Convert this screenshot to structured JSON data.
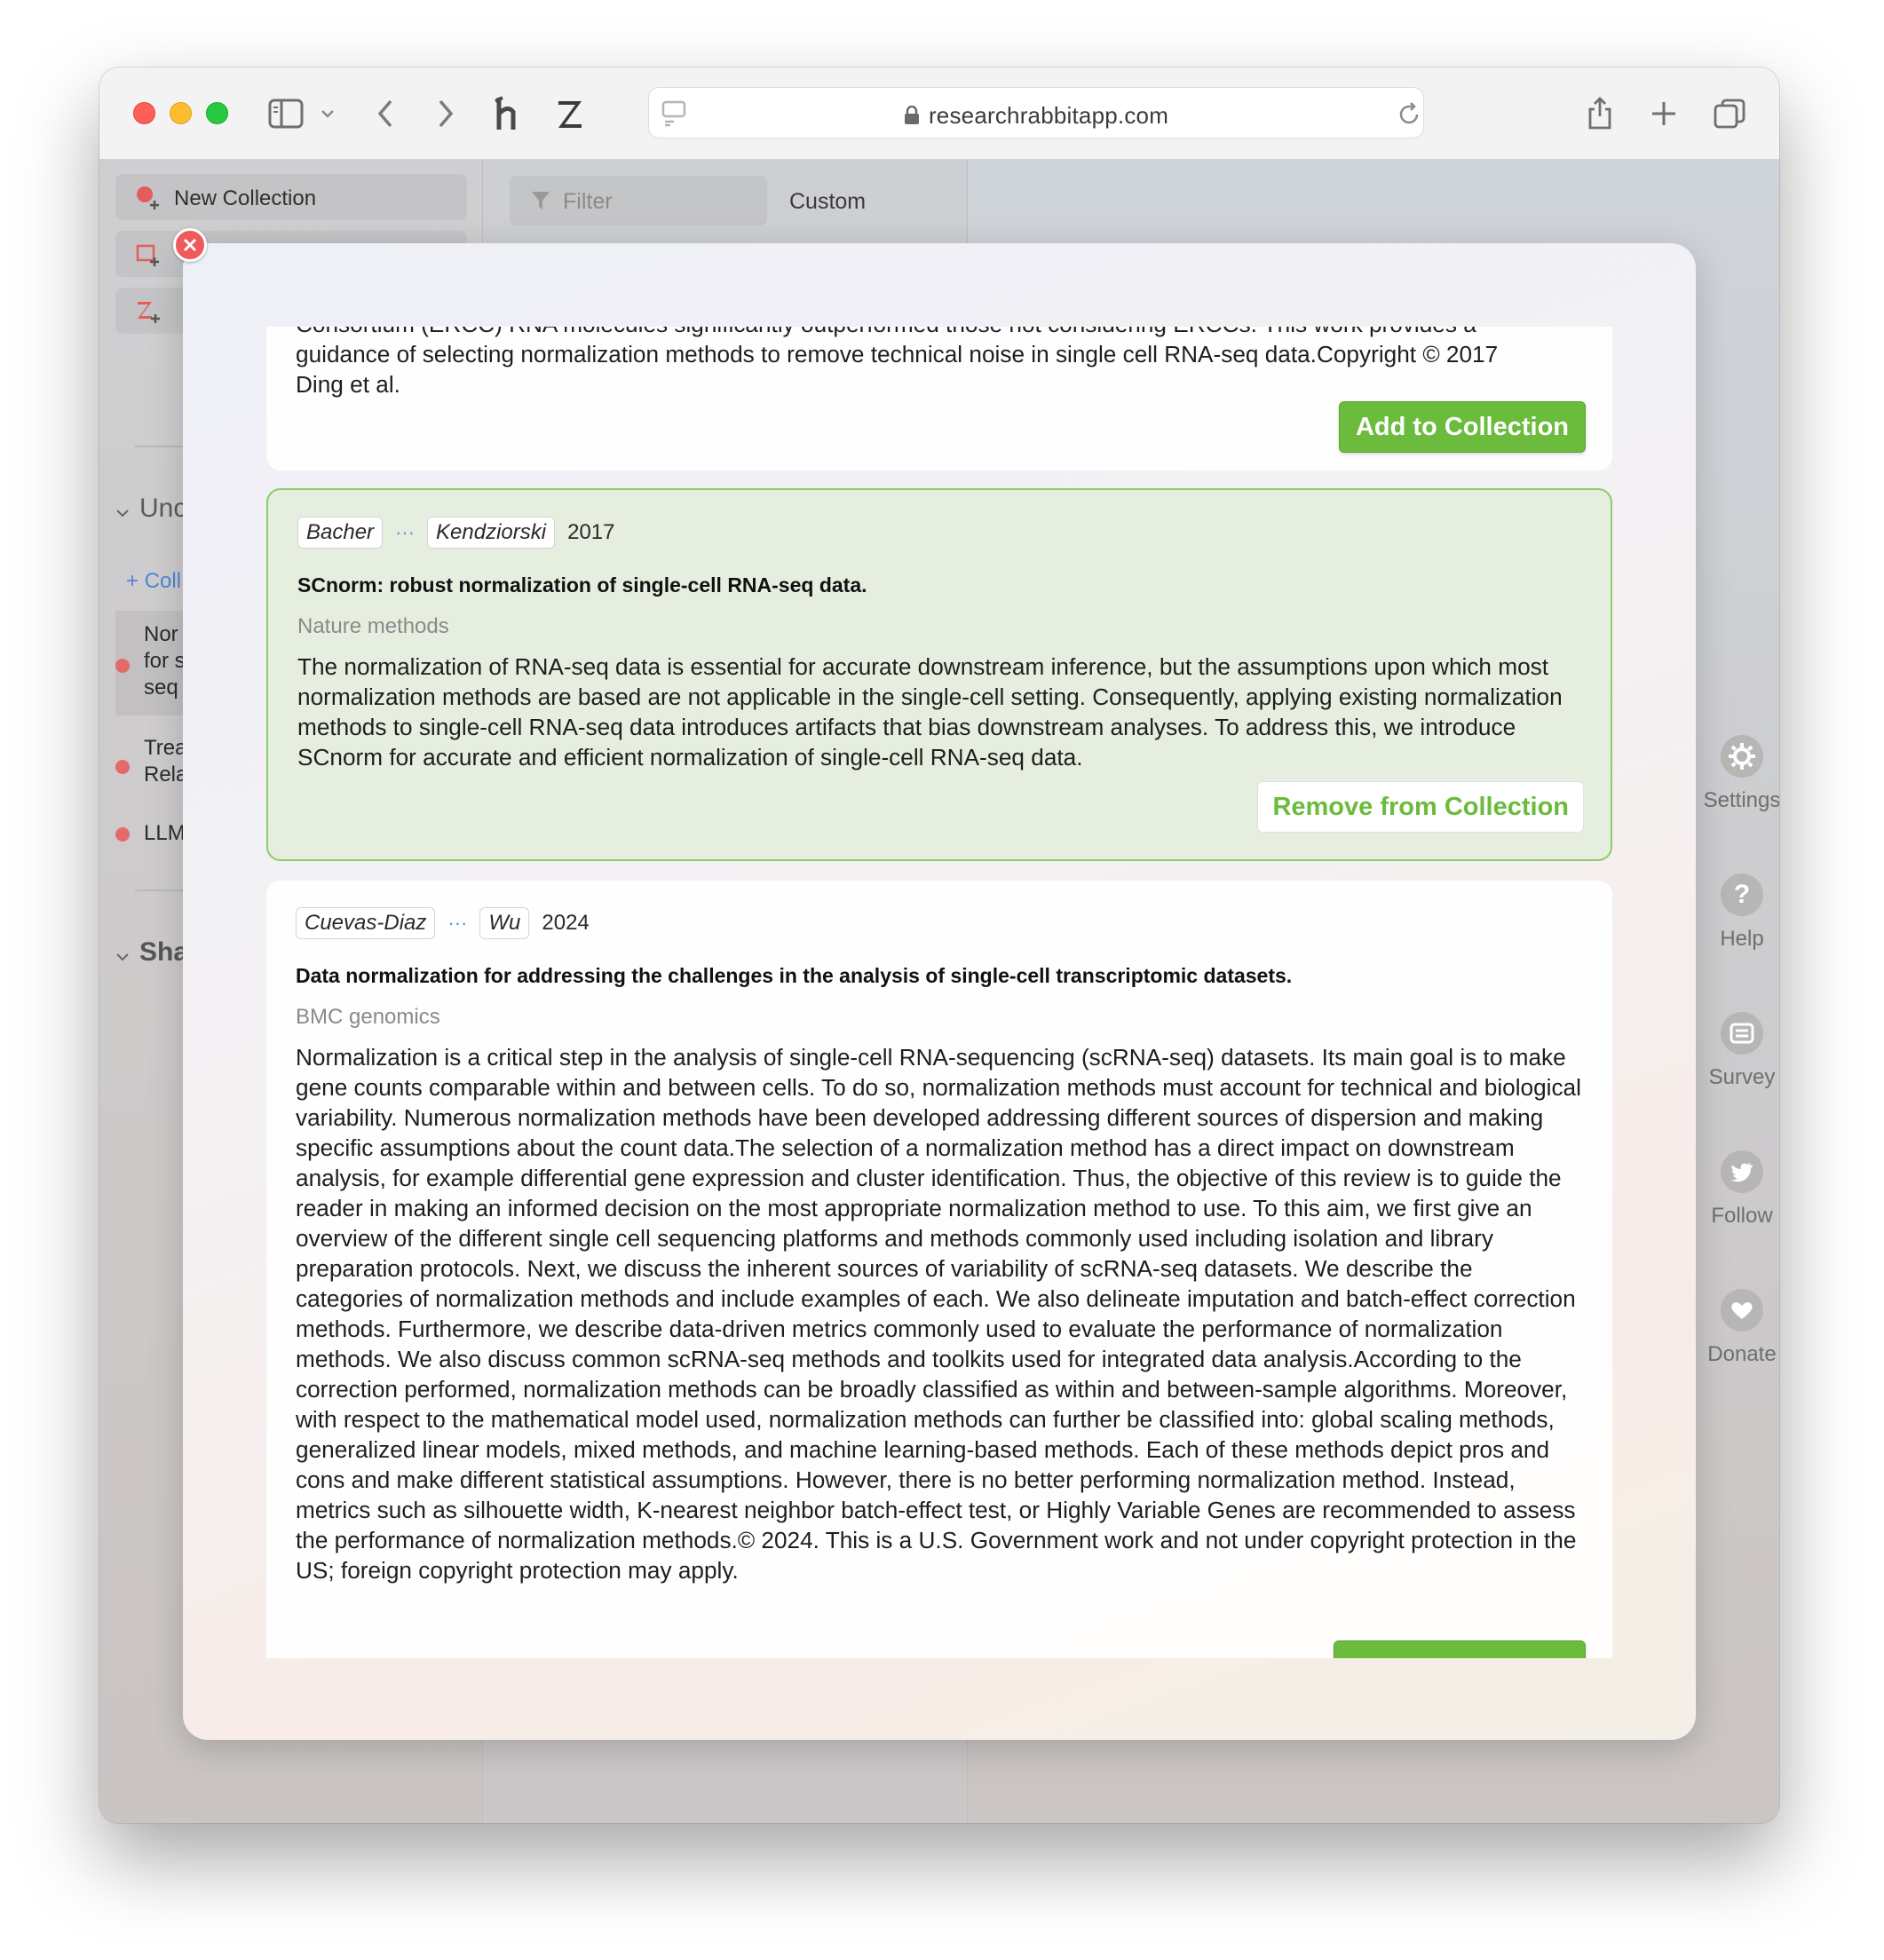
{
  "browser": {
    "url": "researchrabbitapp.com"
  },
  "sidebar": {
    "new_collection": "New Collection",
    "section_uncategorized": "Unc",
    "add_collection_link": "+ Coll",
    "collections": [
      {
        "line1": "Nor",
        "line2": "for s",
        "line3": "seq"
      },
      {
        "line1": "Trea",
        "line2": "Rela"
      },
      {
        "line1": "LLM"
      }
    ],
    "section_shared": "Sha"
  },
  "middle": {
    "filter_placeholder": "Filter",
    "sort_label": "Custom"
  },
  "right_nav": {
    "settings": "Settings",
    "help": "Help",
    "survey": "Survey",
    "follow": "Follow",
    "donate": "Donate"
  },
  "modal": {
    "cards": [
      {
        "abstract_fragment_1": "Consortium (ERCC) RNA molecules significantly outperformed those not considering ERCCs. This work provides a",
        "abstract_fragment_2": "guidance of selecting normalization methods to remove technical noise in single cell RNA-seq data.Copyright © 2017",
        "abstract_fragment_3": "Ding et al.",
        "button": "Add to Collection"
      },
      {
        "author_first": "Bacher",
        "author_more": "···",
        "author_last": "Kendziorski",
        "year": "2017",
        "title": "SCnorm: robust normalization of single-cell RNA-seq data.",
        "journal": "Nature methods",
        "abstract": "The normalization of RNA-seq data is essential for accurate downstream inference, but the assumptions upon which most normalization methods are based are not applicable in the single-cell setting. Consequently, applying existing normalization methods to single-cell RNA-seq data introduces artifacts that bias downstream analyses. To address this, we introduce SCnorm for accurate and efficient normalization of single-cell RNA-seq data.",
        "button": "Remove from Collection"
      },
      {
        "author_first": "Cuevas-Diaz",
        "author_more": "···",
        "author_last": "Wu",
        "year": "2024",
        "title": "Data normalization for addressing the challenges in the analysis of single-cell transcriptomic datasets.",
        "journal": "BMC genomics",
        "abstract": "Normalization is a critical step in the analysis of single-cell RNA-sequencing (scRNA-seq) datasets. Its main goal is to make gene counts comparable within and between cells. To do so, normalization methods must account for technical and biological variability. Numerous normalization methods have been developed addressing different sources of dispersion and making specific assumptions about the count data.The selection of a normalization method has a direct impact on downstream analysis, for example differential gene expression and cluster identification. Thus, the objective of this review is to guide the reader in making an informed decision on the most appropriate normalization method to use. To this aim, we first give an overview of the different single cell sequencing platforms and methods commonly used including isolation and library preparation protocols. Next, we discuss the inherent sources of variability of scRNA-seq datasets. We describe the categories of normalization methods and include examples of each. We also delineate imputation and batch-effect correction methods. Furthermore, we describe data-driven metrics commonly used to evaluate the performance of normalization methods. We also discuss common scRNA-seq methods and toolkits used for integrated data analysis.According to the correction performed, normalization methods can be broadly classified as within and between-sample algorithms. Moreover, with respect to the mathematical model used, normalization methods can further be classified into: global scaling methods, generalized linear models, mixed methods, and machine learning-based methods. Each of these methods depict pros and cons and make different statistical assumptions. However, there is no better performing normalization method. Instead, metrics such as silhouette width, K-nearest neighbor batch-effect test, or Highly Variable Genes are recommended to assess the performance of normalization methods.© 2024. This is a U.S. Government work and not under copyright protection in the US; foreign copyright protection may apply."
      }
    ]
  }
}
